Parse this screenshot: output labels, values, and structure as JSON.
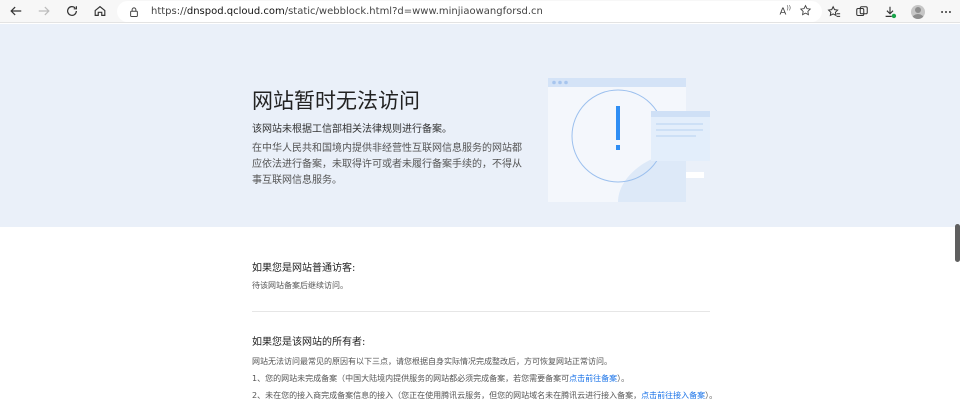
{
  "browser": {
    "url_prefix": "https://",
    "url_host": "dnspod.qcloud.com",
    "url_path": "/static/webblock.html?d=www.minjiaowangforsd.cn",
    "read_aloud_label": "A"
  },
  "hero": {
    "title": "网站暂时无法访问",
    "subtitle": "该网站未根据工信部相关法律规则进行备案。",
    "description": "在中华人民共和国境内提供非经营性互联网信息服务的网站都应依法进行备案，未取得许可或者未履行备案手续的，不得从事互联网信息服务。"
  },
  "visitor": {
    "title": "如果您是网站普通访客:",
    "text": "待该网站备案后继续访问。"
  },
  "owner": {
    "title": "如果您是该网站的所有者:",
    "intro": "网站无法访问最常见的原因有以下三点，请您根据自身实际情况完成整改后，方可恢复网站正常访问。",
    "item1_text": "1、您的网站未完成备案（中国大陆境内提供服务的网站都必须完成备案，若您需要备案可",
    "item1_link": "点击前往备案",
    "item1_end": "）。",
    "item2_text": "2、未在您的接入商完成备案信息的接入（您正在使用腾讯云服务，但您的网站域名未在腾讯云进行接入备案，",
    "item2_link": "点击前往接入备案",
    "item2_end": "）。"
  },
  "colors": {
    "hero_bg": "#eaf0f9",
    "accent": "#2f8ef4",
    "link": "#1a73e8"
  }
}
